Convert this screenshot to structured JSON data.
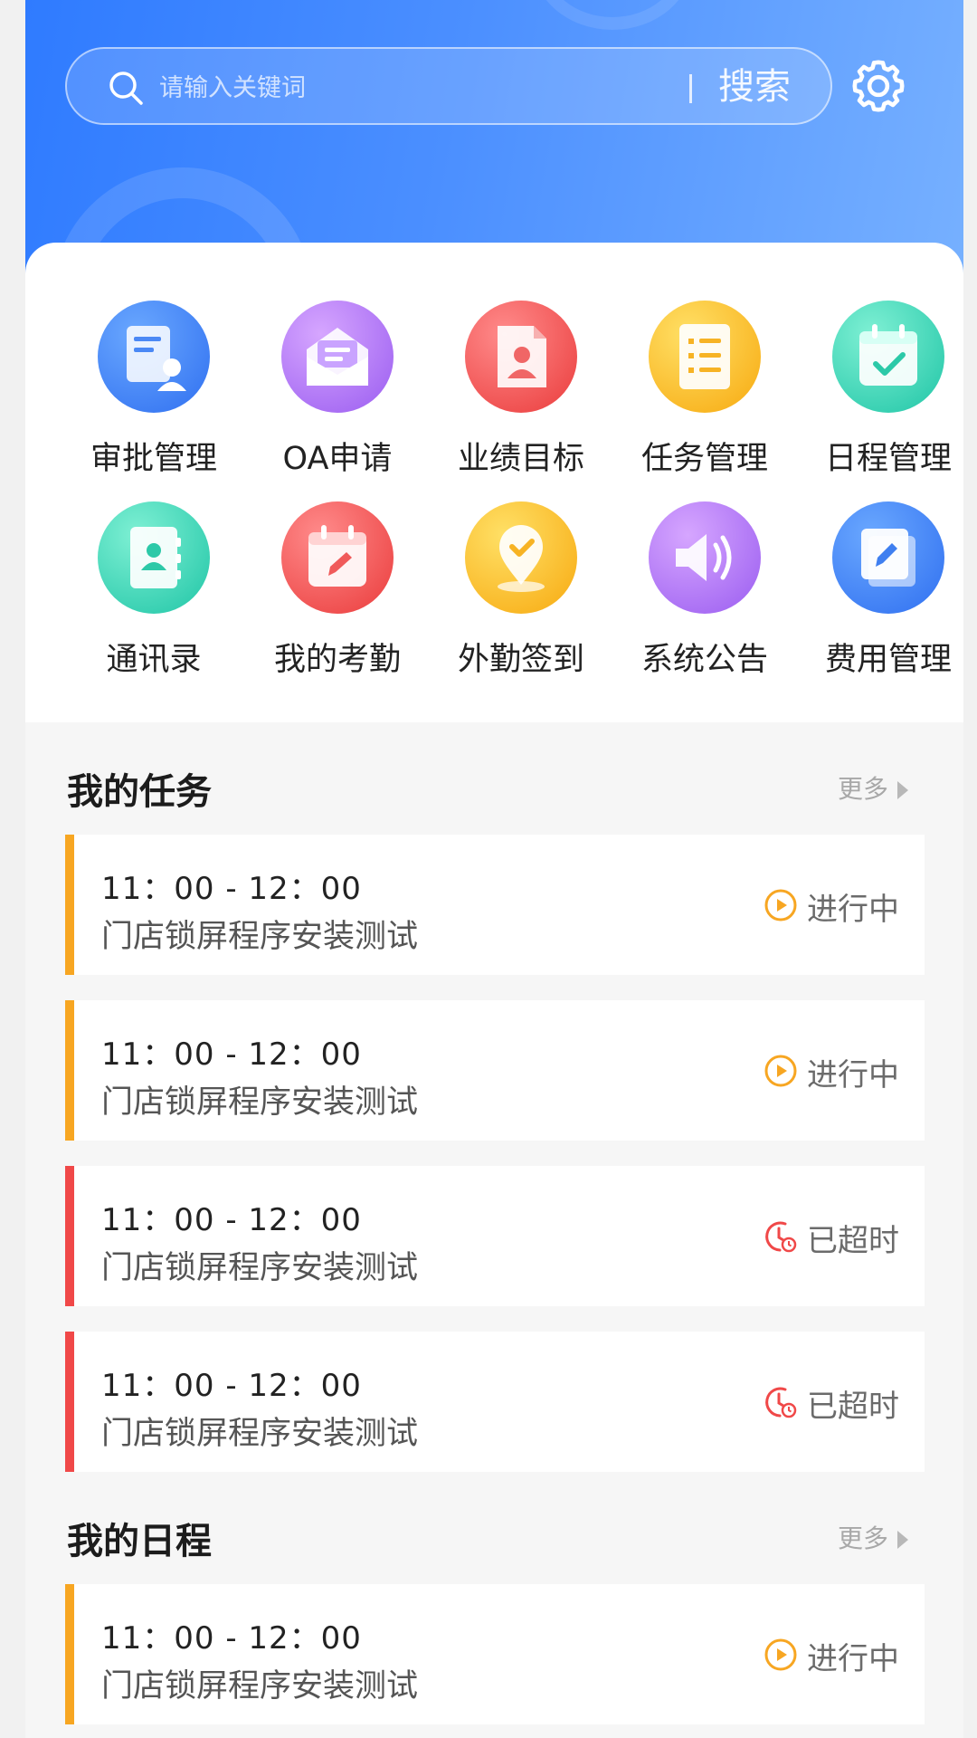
{
  "search": {
    "placeholder": "请输入关键词",
    "button_label": "搜索"
  },
  "colors": {
    "header_start": "#2f7bff",
    "header_end": "#76b0ff",
    "in_progress": "#f7a622",
    "overdue": "#f04848"
  },
  "grid": [
    {
      "label": "审批管理",
      "icon": "approval-icon"
    },
    {
      "label": "OA申请",
      "icon": "mail-icon"
    },
    {
      "label": "业绩目标",
      "icon": "report-icon"
    },
    {
      "label": "任务管理",
      "icon": "tasklist-icon"
    },
    {
      "label": "日程管理",
      "icon": "calendar-check-icon"
    },
    {
      "label": "通讯录",
      "icon": "contacts-icon"
    },
    {
      "label": "我的考勤",
      "icon": "calendar-edit-icon"
    },
    {
      "label": "外勤签到",
      "icon": "location-icon"
    },
    {
      "label": "系统公告",
      "icon": "speaker-icon"
    },
    {
      "label": "费用管理",
      "icon": "edit-note-icon"
    }
  ],
  "tasks": {
    "title": "我的任务",
    "more_label": "更多",
    "items": [
      {
        "time": "11：00 - 12：00",
        "title": "门店锁屏程序安装测试",
        "status": "进行中",
        "state": "in-progress"
      },
      {
        "time": "11：00 - 12：00",
        "title": "门店锁屏程序安装测试",
        "status": "进行中",
        "state": "in-progress"
      },
      {
        "time": "11：00 - 12：00",
        "title": "门店锁屏程序安装测试",
        "status": "已超时",
        "state": "overdue"
      },
      {
        "time": "11：00 - 12：00",
        "title": "门店锁屏程序安装测试",
        "status": "已超时",
        "state": "overdue"
      }
    ]
  },
  "schedule": {
    "title": "我的日程",
    "more_label": "更多",
    "items": [
      {
        "time": "11：00 - 12：00",
        "title": "门店锁屏程序安装测试",
        "status": "进行中",
        "state": "in-progress"
      }
    ]
  }
}
